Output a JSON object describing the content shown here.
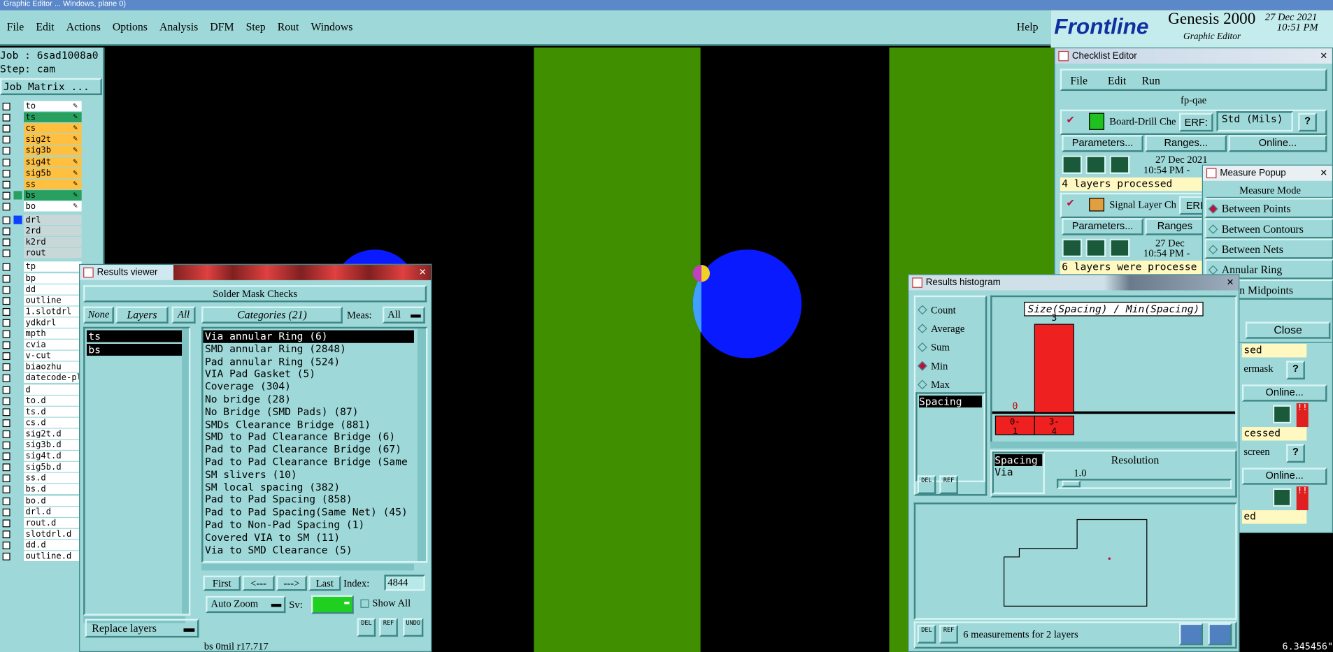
{
  "window_title": "Graphic Editor ...  Windows, plane 0)",
  "menu": [
    "File",
    "Edit",
    "Actions",
    "Options",
    "Analysis",
    "DFM",
    "Step",
    "Rout",
    "Windows"
  ],
  "help": "Help",
  "brand": {
    "logo": "Frontline",
    "product": "Genesis 2000",
    "subtitle": "Graphic Editor",
    "date": "27 Dec 2021",
    "time": "10:51 PM"
  },
  "job": {
    "job_line": "Job : 6sad1008a0",
    "step_line": "Step: cam",
    "matrix_button": "Job Matrix ..."
  },
  "layers_board": [
    {
      "name": "to",
      "color": "#ffffff"
    },
    {
      "name": "ts",
      "color": "#28a060"
    },
    {
      "name": "cs",
      "color": "#ffc040"
    },
    {
      "name": "sig2t",
      "color": "#ffc040"
    },
    {
      "name": "sig3b",
      "color": "#ffc040"
    },
    {
      "name": "sig4t",
      "color": "#ffc040"
    },
    {
      "name": "sig5b",
      "color": "#ffc040"
    },
    {
      "name": "ss",
      "color": "#ffc040"
    },
    {
      "name": "bs",
      "color": "#28a060"
    },
    {
      "name": "bo",
      "color": "#ffffff"
    }
  ],
  "layers_drill": [
    "drl",
    "2rd",
    "k2rd",
    "rout"
  ],
  "layers_misc": [
    "tp",
    "bp",
    "dd",
    "outline",
    "1.slotdrl",
    "ydkdrl",
    "mpth",
    "cvia",
    "v-cut",
    "biaozhu",
    "datecode-pl",
    "d",
    "to.d",
    "ts.d",
    "cs.d",
    "sig2t.d",
    "sig3b.d",
    "sig4t.d",
    "sig5b.d",
    "ss.d",
    "bs.d",
    "bo.d",
    "drl.d",
    "rout.d",
    "slotdrl.d",
    "dd.d",
    "outline.d"
  ],
  "results_viewer": {
    "title": "Results viewer",
    "header": "Solder Mask Checks",
    "none": "None",
    "layers": "Layers",
    "all": "All",
    "categories_label": "Categories (21)",
    "meas_label": "Meas:",
    "meas_value": "All",
    "layer_items": [
      "ts",
      "bs"
    ],
    "categories": [
      "Via annular Ring (6)",
      "SMD annular Ring (2848)",
      "Pad annular Ring (524)",
      "VIA Pad Gasket (5)",
      "Coverage (304)",
      "No bridge (28)",
      "No Bridge (SMD Pads) (87)",
      "SMDs Clearance Bridge (881)",
      "SMD to Pad Clearance Bridge (6)",
      "Pad to Pad Clearance Bridge (67)",
      "Pad to Pad Clearance Bridge (Same",
      "SM slivers (10)",
      "SM local spacing (382)",
      "Pad to Pad Spacing (858)",
      "Pad to Pad Spacing(Same Net) (45)",
      "Pad to Non-Pad Spacing (1)",
      "Covered VIA to SM (11)",
      "Via to SMD Clearance (5)"
    ],
    "first": "First",
    "prev": "<---",
    "next": "--->",
    "last": "Last",
    "index_label": "Index:",
    "index_value": "4844",
    "auto_zoom": "Auto Zoom",
    "sv": "Sv:",
    "show_all": "Show All",
    "replace_layers": "Replace layers",
    "del": "DEL",
    "ref": "REF",
    "undo": "UNDO",
    "status": "bs 0mil  r17.717"
  },
  "checklist": {
    "title": "Checklist Editor",
    "menu": [
      "File",
      "Edit",
      "Run"
    ],
    "name": "fp-qae",
    "check1": "Board-Drill Che",
    "erf": "ERF:",
    "erf_value": "Std (Mils)",
    "q": "?",
    "parameters": "Parameters...",
    "ranges": "Ranges...",
    "online": "Online...",
    "date1": "27 Dec 2021",
    "time1": "10:54 PM -",
    "msg1": "4 layers processed",
    "check2": "Signal Layer Ch",
    "erf2": "ERF",
    "ranges2": "Ranges",
    "date2": "27 Dec",
    "time2": "10:54 PM -",
    "msg2": "6 layers were processe",
    "r_sed": "sed",
    "r_ermask": "ermask",
    "r_online2": "Online...",
    "r_cessed": "cessed",
    "r_screen": "screen",
    "r_online3": "Online...",
    "r_ed": "ed"
  },
  "measure": {
    "title": "Measure Popup",
    "mode": "Measure Mode",
    "options": [
      "Between Points",
      "Between Contours",
      "Between Nets",
      "Annular Ring",
      "ween Midpoints"
    ],
    "close": "Close",
    "coord": "6.345456\""
  },
  "histogram": {
    "title": "Results histogram",
    "options": [
      "Count",
      "Average",
      "Sum",
      "Min",
      "Max"
    ],
    "selected": "Min",
    "list": [
      "Spacing"
    ],
    "chart_title": "Size(Spacing) / Min(Spacing)",
    "bins": [
      {
        "label": "0-1",
        "value": 0
      },
      {
        "label": "3-4",
        "value": 3
      }
    ],
    "lower_list": [
      "Spacing",
      "Via"
    ],
    "resolution_label": "Resolution",
    "resolution_value": "1.0",
    "status": "6 measurements for 2 layers",
    "del": "DEL",
    "ref": "REF"
  }
}
